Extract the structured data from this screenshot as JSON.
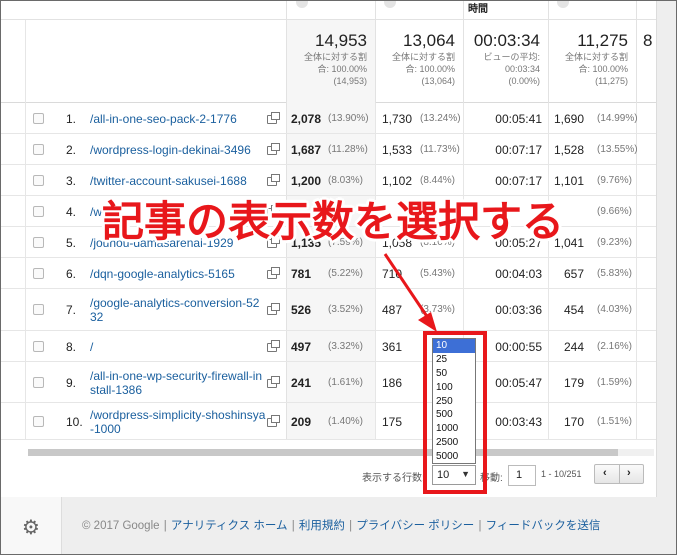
{
  "header": {
    "time_label": "時間"
  },
  "totals": [
    {
      "value": "14,953",
      "sub1": "全体に対する割",
      "sub2": "合: 100.00%",
      "sub3": "(14,953)"
    },
    {
      "value": "13,064",
      "sub1": "全体に対する割",
      "sub2": "合: 100.00%",
      "sub3": "(13,064)"
    },
    {
      "value": "00:03:34",
      "sub1": "ビューの平均:",
      "sub2": "00:03:34",
      "sub3": "(0.00%)"
    },
    {
      "value": "11,275",
      "sub1": "全体に対する割",
      "sub2": "合: 100.00%",
      "sub3": "(11,275)"
    },
    {
      "value": "8"
    }
  ],
  "rows": [
    {
      "idx": "1.",
      "page": "/all-in-one-seo-pack-2-1776",
      "v1": "2,078",
      "p1": "(13.90%)",
      "v2": "1,730",
      "p2": "(13.24%)",
      "v3": "00:05:41",
      "v4": "1,690",
      "p4": "(14.99%)"
    },
    {
      "idx": "2.",
      "page": "/wordpress-login-dekinai-3496",
      "v1": "1,687",
      "p1": "(11.28%)",
      "v2": "1,533",
      "p2": "(11.73%)",
      "v3": "00:07:17",
      "v4": "1,528",
      "p4": "(13.55%)"
    },
    {
      "idx": "3.",
      "page": "/twitter-account-sakusei-1688",
      "v1": "1,200",
      "p1": "(8.03%)",
      "v2": "1,102",
      "p2": "(8.44%)",
      "v3": "00:07:17",
      "v4": "1,101",
      "p4": "(9.76%)"
    },
    {
      "idx": "4.",
      "page": "/wr",
      "v1": "",
      "p1": "",
      "v2": "",
      "p2": "",
      "v3": "",
      "v4": "",
      "p4": "(9.66%)"
    },
    {
      "idx": "5.",
      "page": "/jouhou-damasarenai-1929",
      "v1": "1,135",
      "p1": "(7.59%)",
      "v2": "1,058",
      "p2": "(8.10%)",
      "v3": "00:05:27",
      "v4": "1,041",
      "p4": "(9.23%)"
    },
    {
      "idx": "6.",
      "page": "/dqn-google-analytics-5165",
      "v1": "781",
      "p1": "(5.22%)",
      "v2": "710",
      "p2": "(5.43%)",
      "v3": "00:04:03",
      "v4": "657",
      "p4": "(5.83%)"
    },
    {
      "idx": "7.",
      "page": "/google-analytics-conversion-5232",
      "v1": "526",
      "p1": "(3.52%)",
      "v2": "487",
      "p2": "(3.73%)",
      "v3": "00:03:36",
      "v4": "454",
      "p4": "(4.03%)"
    },
    {
      "idx": "8.",
      "page": "/",
      "v1": "497",
      "p1": "(3.32%)",
      "v2": "361",
      "p2": "",
      "v3": "00:00:55",
      "v4": "244",
      "p4": "(2.16%)"
    },
    {
      "idx": "9.",
      "page": "/all-in-one-wp-security-firewall-install-1386",
      "v1": "241",
      "p1": "(1.61%)",
      "v2": "186",
      "p2": "",
      "v3": "00:05:47",
      "v4": "179",
      "p4": "(1.59%)"
    },
    {
      "idx": "10.",
      "page": "/wordpress-simplicity-shoshinsya-1000",
      "v1": "209",
      "p1": "(1.40%)",
      "v2": "175",
      "p2": "",
      "v3": "00:03:43",
      "v4": "170",
      "p4": "(1.51%)"
    }
  ],
  "pager": {
    "rows_label": "表示する行数:",
    "selected": "10",
    "goto_label": "移動:",
    "goto_value": "1",
    "range": "1 - 10/251",
    "prev": "‹",
    "next": "›",
    "options": [
      "10",
      "25",
      "50",
      "100",
      "250",
      "500",
      "1000",
      "2500",
      "5000"
    ]
  },
  "annotation": {
    "text": "記事の表示数を選択する",
    "color": "#e8171b"
  },
  "footer": {
    "copyright": "© 2017 Google",
    "links": [
      "アナリティクス ホーム",
      "利用規約",
      "プライバシー ポリシー",
      "フィードバックを送信"
    ]
  },
  "icons": {
    "settings": "gear-icon",
    "external": "external-link-icon"
  }
}
